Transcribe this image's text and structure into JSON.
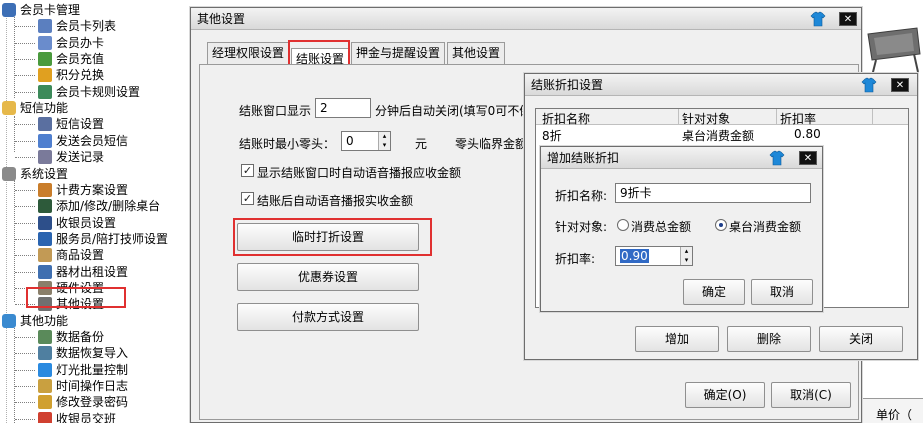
{
  "tree": {
    "items": [
      {
        "label": "会员卡管理",
        "level": 0,
        "icon": "member-icon"
      },
      {
        "label": "会员卡列表",
        "level": 1,
        "icon": "card-list-icon"
      },
      {
        "label": "会员办卡",
        "level": 1,
        "icon": "new-card-icon"
      },
      {
        "label": "会员充值",
        "level": 1,
        "icon": "recharge-icon"
      },
      {
        "label": "积分兑换",
        "level": 1,
        "icon": "gift-icon"
      },
      {
        "label": "会员卡规则设置",
        "level": 1,
        "icon": "rule-icon"
      },
      {
        "label": "短信功能",
        "level": 0,
        "icon": "sms-folder-icon"
      },
      {
        "label": "短信设置",
        "level": 1,
        "icon": "sms-settings-icon"
      },
      {
        "label": "发送会员短信",
        "level": 1,
        "icon": "send-sms-icon"
      },
      {
        "label": "发送记录",
        "level": 1,
        "icon": "send-log-icon"
      },
      {
        "label": "系统设置",
        "level": 0,
        "icon": "gear-icon"
      },
      {
        "label": "计费方案设置",
        "level": 1,
        "icon": "billing-icon"
      },
      {
        "label": "添加/修改/删除桌台",
        "level": 1,
        "icon": "table-icon"
      },
      {
        "label": "收银员设置",
        "level": 1,
        "icon": "cashier-icon"
      },
      {
        "label": "服务员/陪打技师设置",
        "level": 1,
        "icon": "staff-icon"
      },
      {
        "label": "商品设置",
        "level": 1,
        "icon": "goods-icon"
      },
      {
        "label": "器材出租设置",
        "level": 1,
        "icon": "rental-icon"
      },
      {
        "label": "硬件设置",
        "level": 1,
        "icon": "hardware-icon"
      },
      {
        "label": "其他设置",
        "level": 1,
        "icon": "tools-icon"
      },
      {
        "label": "其他功能",
        "level": 0,
        "icon": "other-folder-icon"
      },
      {
        "label": "数据备份",
        "level": 1,
        "icon": "backup-icon"
      },
      {
        "label": "数据恢复导入",
        "level": 1,
        "icon": "restore-icon"
      },
      {
        "label": "灯光批量控制",
        "level": 1,
        "icon": "light-icon"
      },
      {
        "label": "时间操作日志",
        "level": 1,
        "icon": "log-icon"
      },
      {
        "label": "修改登录密码",
        "level": 1,
        "icon": "key-icon"
      },
      {
        "label": "收银员交班",
        "level": 1,
        "icon": "shift-icon"
      }
    ]
  },
  "main_window": {
    "title": "其他设置",
    "tabs": [
      "经理权限设置",
      "结账设置",
      "押金与提醒设置",
      "其他设置"
    ],
    "active_tab": "结账设置",
    "checkout_display_label": "结账窗口显示",
    "checkout_display_value": "2",
    "checkout_display_suffix": "分钟后自动关闭(填写0可不倒",
    "min_change_label": "结账时最小零头：",
    "min_change_value": "0",
    "min_change_unit": "元",
    "odd_threshold_label": "零头临界金额",
    "chk_voice_receivable": "显示结账窗口时自动语音播报应收金额",
    "chk_voice_paid": "结账后自动语音播报实收金额",
    "btn_temp_discount": "临时打折设置",
    "btn_coupon": "优惠券设置",
    "btn_payment": "付款方式设置",
    "btn_ok": "确定(O)",
    "btn_cancel": "取消(C)"
  },
  "discount_window": {
    "title": "结账折扣设置",
    "columns": [
      "折扣名称",
      "针对对象",
      "折扣率"
    ],
    "rows": [
      {
        "name": "8折",
        "target": "桌台消费金额",
        "rate": "0.80"
      }
    ],
    "btn_add": "增加",
    "btn_delete": "删除",
    "btn_close": "关闭"
  },
  "add_dialog": {
    "title": "增加结账折扣",
    "name_label": "折扣名称:",
    "name_value": "9折卡",
    "target_label": "针对对象:",
    "option_total": "消费总金额",
    "option_table": "桌台消费金额",
    "selected_option": "桌台消费金额",
    "rate_label": "折扣率:",
    "rate_value": "0.90",
    "btn_ok": "确定",
    "btn_cancel": "取消"
  },
  "background": {
    "unit_label": "单价（"
  },
  "colors": {
    "highlight": "#e03030",
    "selection": "#316ac5",
    "title_gradient_top": "#f3f3f3",
    "title_gradient_bottom": "#d9d9d9"
  }
}
